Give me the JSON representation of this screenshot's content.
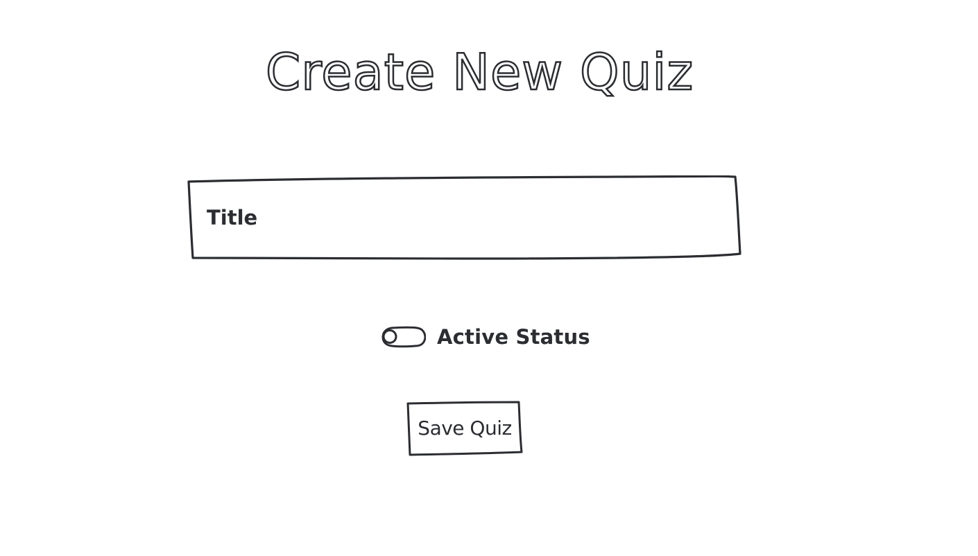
{
  "page": {
    "title": "Create New Quiz"
  },
  "form": {
    "title_field": {
      "placeholder": "Title",
      "value": ""
    },
    "active_status": {
      "label": "Active Status",
      "checked": false
    },
    "save_button": {
      "label": "Save Quiz"
    }
  },
  "colors": {
    "ink": "#2b2d31",
    "background": "#ffffff"
  }
}
